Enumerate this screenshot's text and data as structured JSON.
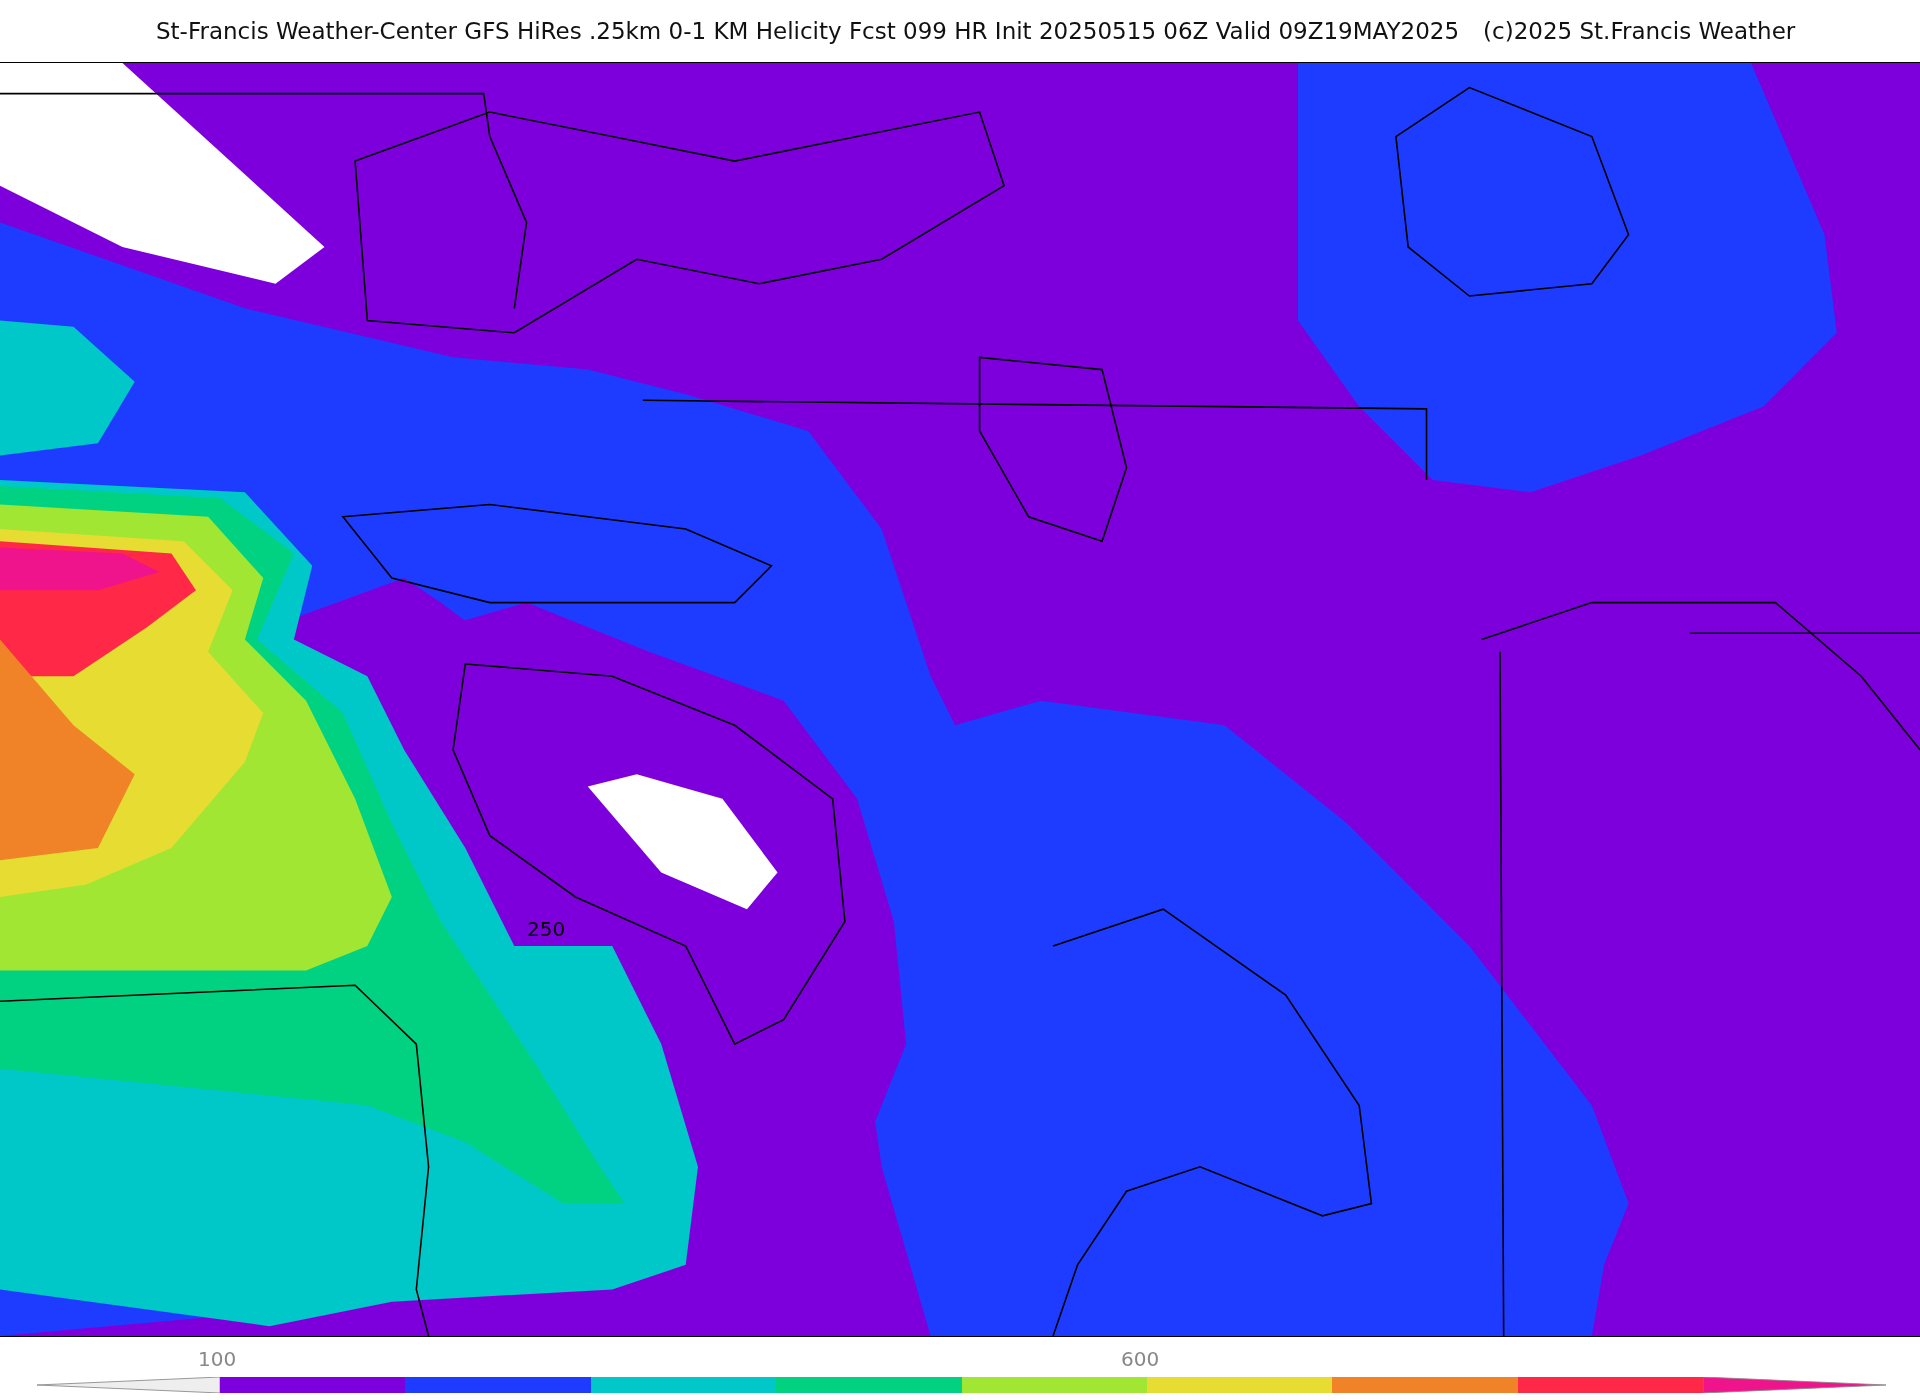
{
  "title": {
    "main": "St-Francis Weather-Center GFS HiRes .25km 0-1 KM Helicity Fcst 099 HR Init 20250515 06Z  Valid 09Z19MAY2025",
    "credit": "(c)2025 St.Francis Weather"
  },
  "map": {
    "contour_label": "250"
  },
  "colorbar": {
    "labels": [
      "100",
      "600"
    ],
    "bins": [
      {
        "kind": "arrow-left",
        "color": "#eeeeee"
      },
      {
        "kind": "bar",
        "color": "#7d00dc"
      },
      {
        "kind": "bar",
        "color": "#1e3cff"
      },
      {
        "kind": "bar",
        "color": "#00c8c8"
      },
      {
        "kind": "bar",
        "color": "#00d282"
      },
      {
        "kind": "bar",
        "color": "#a0e632"
      },
      {
        "kind": "bar",
        "color": "#e6dc32"
      },
      {
        "kind": "bar",
        "color": "#f08228"
      },
      {
        "kind": "bar",
        "color": "#ff2846"
      },
      {
        "kind": "arrow-right",
        "color": "#f0148c"
      }
    ]
  }
}
